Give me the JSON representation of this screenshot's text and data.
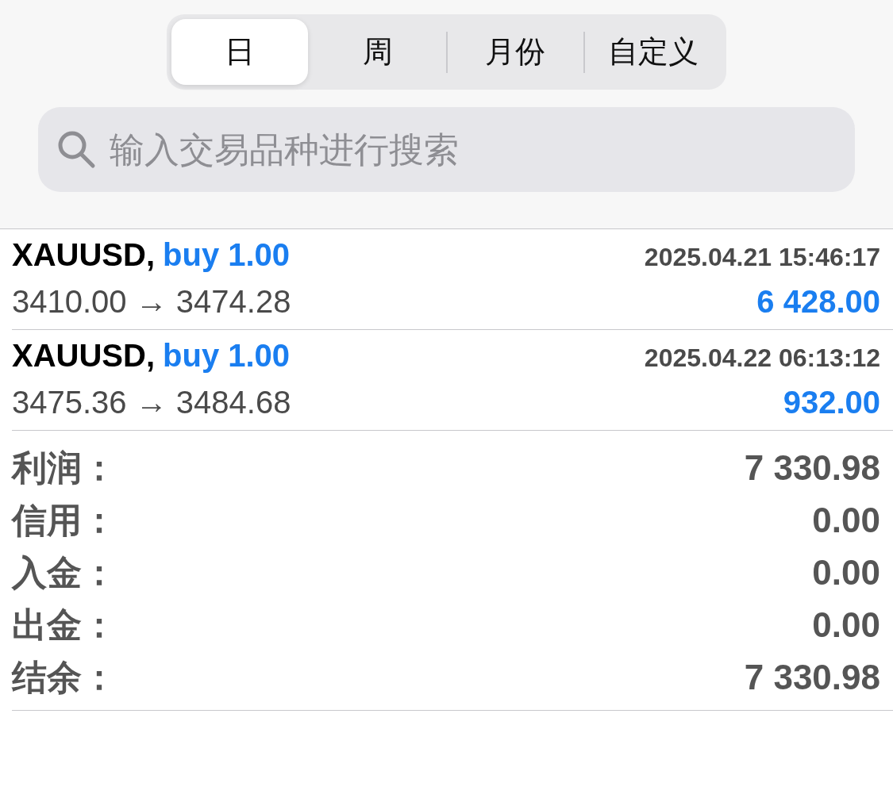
{
  "segments": [
    {
      "label": "日",
      "selected": true
    },
    {
      "label": "周",
      "selected": false
    },
    {
      "label": "月份",
      "selected": false
    },
    {
      "label": "自定义",
      "selected": false
    }
  ],
  "search": {
    "placeholder": "输入交易品种进行搜索"
  },
  "trades": [
    {
      "symbol": "XAUUSD,",
      "side": "buy 1.00",
      "time": "2025.04.21 15:46:17",
      "prices": "3410.00 → 3474.28",
      "profit": "6 428.00"
    },
    {
      "symbol": "XAUUSD,",
      "side": "buy 1.00",
      "time": "2025.04.22 06:13:12",
      "prices": "3475.36 → 3484.68",
      "profit": "932.00"
    }
  ],
  "summary": [
    {
      "label": "利润：",
      "value": "7 330.98"
    },
    {
      "label": "信用：",
      "value": "0.00"
    },
    {
      "label": "入金：",
      "value": "0.00"
    },
    {
      "label": "出金：",
      "value": "0.00"
    },
    {
      "label": "结余：",
      "value": "7 330.98"
    }
  ]
}
